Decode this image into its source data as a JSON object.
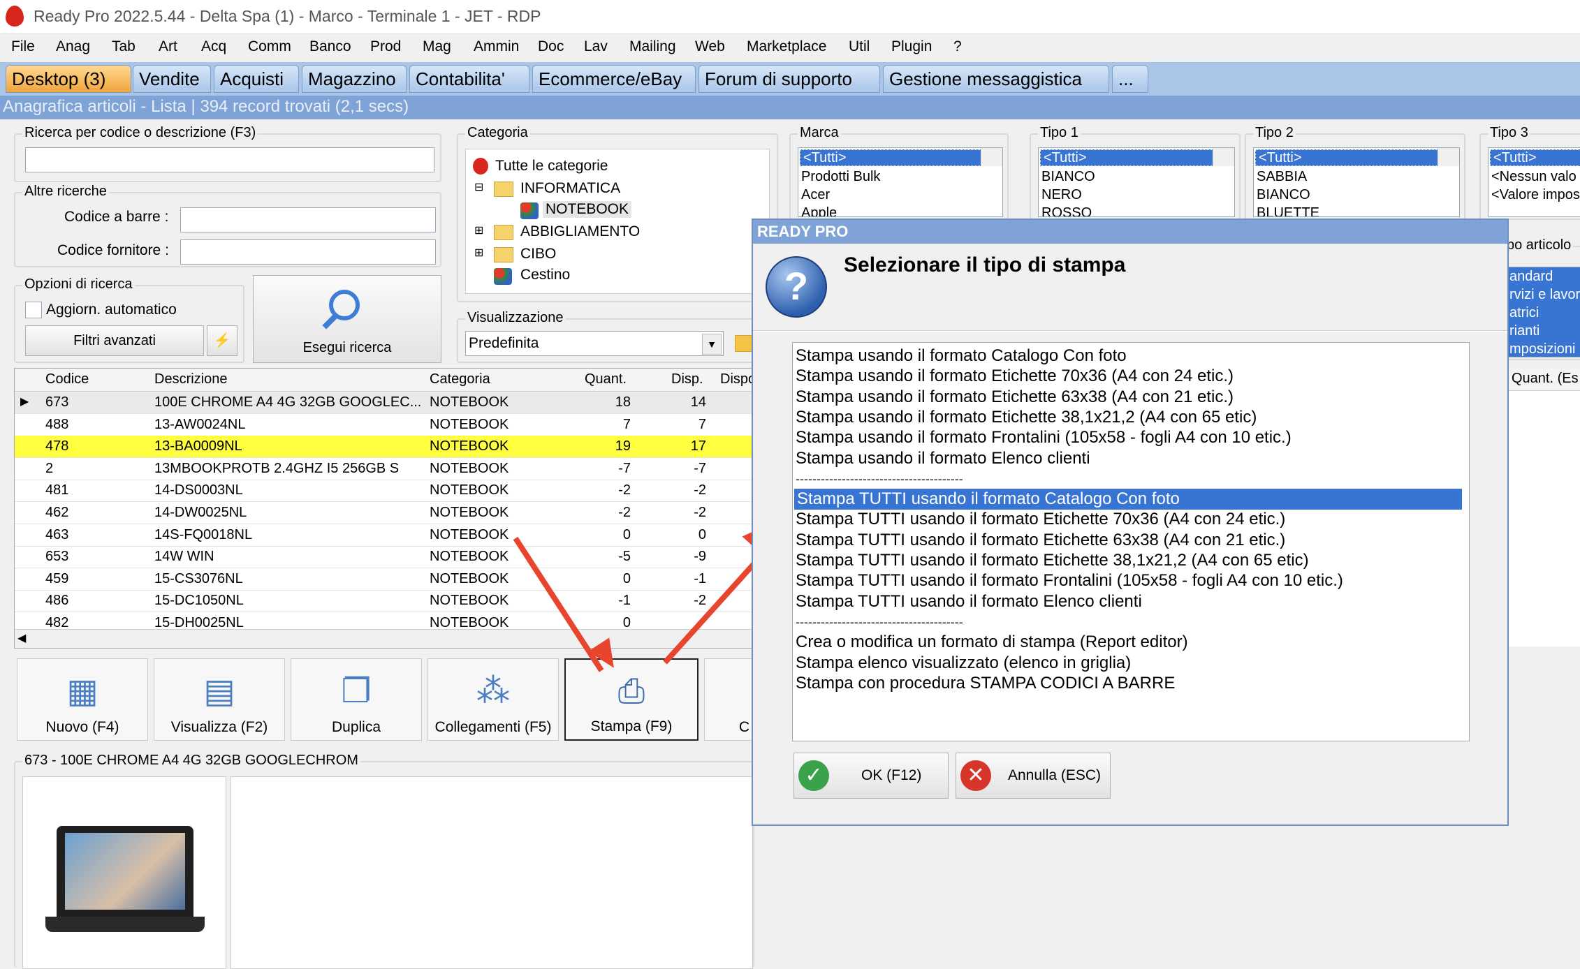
{
  "window": {
    "title": "Ready Pro 2022.5.44 - Delta Spa (1) - Marco - Terminale 1 - JET - RDP"
  },
  "menu": [
    "File",
    "Anag",
    "Tab",
    "Art",
    "Acq",
    "Comm",
    "Banco",
    "Prod",
    "Mag",
    "Ammin",
    "Doc",
    "Lav",
    "Mailing",
    "Web",
    "Marketplace",
    "Util",
    "Plugin",
    "?"
  ],
  "tabs": [
    "Desktop (3)",
    "Vendite",
    "Acquisti",
    "Magazzino",
    "Contabilita'",
    "Ecommerce/eBay",
    "Forum di supporto",
    "Gestione messaggistica",
    "..."
  ],
  "subtitle": "Anagrafica articoli  - Lista | 394 record trovati (2,1 secs)",
  "search": {
    "group_label": "Ricerca per codice o descrizione (F3)",
    "altre_label": "Altre ricerche",
    "barcode_label": "Codice a barre :",
    "supplier_label": "Codice fornitore :",
    "options_label": "Opzioni di ricerca",
    "auto_update": "Aggiorn. automatico",
    "advanced_filters": "Filtri avanzati",
    "run_search": "Esegui ricerca"
  },
  "categoria": {
    "label": "Categoria",
    "items": [
      "Tutte le categorie",
      "INFORMATICA",
      "NOTEBOOK",
      "ABBIGLIAMENTO",
      "CIBO",
      "Cestino"
    ]
  },
  "visualizzazione": {
    "label": "Visualizzazione",
    "value": "Predefinita"
  },
  "marca": {
    "label": "Marca",
    "items": [
      "<Tutti>",
      "Prodotti Bulk",
      "Acer",
      "Apple"
    ]
  },
  "tipo1": {
    "label": "Tipo 1",
    "items": [
      "<Tutti>",
      "BIANCO",
      "NERO",
      "ROSSO"
    ]
  },
  "tipo2": {
    "label": "Tipo 2",
    "items": [
      "<Tutti>",
      "SABBIA",
      "BIANCO",
      "BLUETTE"
    ]
  },
  "tipo3": {
    "label": "Tipo 3",
    "items": [
      "<Tutti>",
      "<Nessun valo",
      "<Valore impos"
    ]
  },
  "tipo_articolo": {
    "label": "po articolo",
    "items": [
      "andard",
      "rvizi e lavor",
      "atrici",
      "rianti",
      "mposizioni"
    ]
  },
  "grid": {
    "headers": [
      "Codice",
      "Descrizione",
      "Categoria",
      "Quant.",
      "Disp.",
      "Dispo"
    ],
    "right_header": "Quant. (Es",
    "rows": [
      [
        "673",
        "100E CHROME A4 4G 32GB GOOGLEC...",
        "NOTEBOOK",
        "18",
        "14"
      ],
      [
        "488",
        "13-AW0024NL",
        "NOTEBOOK",
        "7",
        "7"
      ],
      [
        "478",
        "13-BA0009NL",
        "NOTEBOOK",
        "19",
        "17"
      ],
      [
        "2",
        "13MBOOKPROTB 2.4GHZ I5 256GB S",
        "NOTEBOOK",
        "-7",
        "-7"
      ],
      [
        "481",
        "14-DS0003NL",
        "NOTEBOOK",
        "-2",
        "-2"
      ],
      [
        "462",
        "14-DW0025NL",
        "NOTEBOOK",
        "-2",
        "-2"
      ],
      [
        "463",
        "14S-FQ0018NL",
        "NOTEBOOK",
        "0",
        "0"
      ],
      [
        "653",
        "14W WIN",
        "NOTEBOOK",
        "-5",
        "-9"
      ],
      [
        "459",
        "15-CS3076NL",
        "NOTEBOOK",
        "0",
        "-1"
      ],
      [
        "486",
        "15-DC1050NL",
        "NOTEBOOK",
        "-1",
        "-2"
      ],
      [
        "482",
        "15-DH0025NL",
        "NOTEBOOK",
        "0",
        ""
      ]
    ]
  },
  "toolbar": [
    "Nuovo (F4)",
    "Visualizza (F2)",
    "Duplica",
    "Collegamenti (F5)",
    "Stampa (F9)",
    "C"
  ],
  "detail_label": "673 - 100E CHROME A4 4G 32GB GOOGLECHROM",
  "dialog": {
    "title": "READY PRO",
    "heading": "Selezionare il tipo di stampa",
    "options": [
      "Stampa usando il formato Catalogo Con foto",
      "Stampa usando il formato Etichette 70x36 (A4 con 24 etic.)",
      "Stampa usando il formato Etichette 63x38 (A4 con 21 etic.)",
      "Stampa usando il formato Etichette 38,1x21,2 (A4 con 65 etic)",
      "Stampa usando il formato Frontalini (105x58 - fogli A4 con 10 etic.)",
      "Stampa usando il formato Elenco clienti",
      "----------------------------------------",
      "Stampa TUTTI usando il formato Catalogo Con foto",
      "Stampa TUTTI usando il formato Etichette 70x36 (A4 con 24 etic.)",
      "Stampa TUTTI usando il formato Etichette 63x38 (A4 con 21 etic.)",
      "Stampa TUTTI usando il formato Etichette 38,1x21,2 (A4 con 65 etic)",
      "Stampa TUTTI usando il formato Frontalini (105x58 - fogli A4 con 10 etic.)",
      "Stampa TUTTI usando il formato Elenco clienti",
      "----------------------------------------",
      "Crea o modifica un formato di stampa (Report editor)",
      "Stampa elenco visualizzato (elenco in griglia)",
      "Stampa con procedura STAMPA CODICI A BARRE"
    ],
    "selected_index": 7,
    "ok_label": "OK (F12)",
    "cancel_label": "Annulla (ESC)"
  },
  "colors": {
    "selection": "#3874d2",
    "highlight_row": "#ffff40",
    "arrow": "#e8452e",
    "tab_active": "#f0a53a"
  }
}
